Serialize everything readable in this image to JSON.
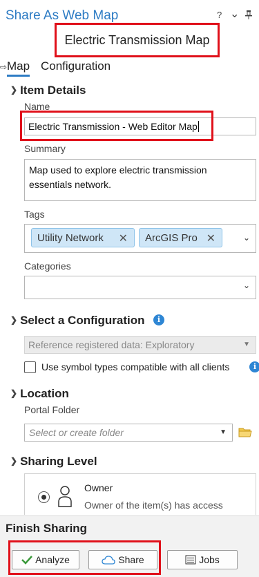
{
  "pane": {
    "title": "Share As Web Map",
    "help": "?",
    "menu_arrow": "⌄",
    "pin": "📌"
  },
  "map_title": "Electric Transmission Map",
  "tabs": [
    {
      "label": "Map",
      "active": true
    },
    {
      "label": "Configuration",
      "active": false
    }
  ],
  "item_details": {
    "header": "Item Details",
    "name_label": "Name",
    "name_value": "Electric Transmission - Web Editor Map",
    "summary_label": "Summary",
    "summary_value": "Map used to explore electric transmission essentials network.",
    "tags_label": "Tags",
    "tags": [
      "Utility Network",
      "ArcGIS Pro"
    ],
    "categories_label": "Categories",
    "categories_value": ""
  },
  "configuration": {
    "header": "Select a Configuration",
    "selected": "Reference registered data: Exploratory",
    "checkbox_label": "Use symbol types compatible with all clients",
    "checked": false
  },
  "location": {
    "header": "Location",
    "portal_folder_label": "Portal Folder",
    "folder_placeholder": "Select or create folder"
  },
  "sharing_level": {
    "header": "Sharing Level",
    "option_label": "Owner",
    "option_desc": "Owner of the item(s) has access",
    "selected": true
  },
  "finish": {
    "header": "Finish Sharing",
    "analyze_label": "Analyze",
    "share_label": "Share",
    "jobs_label": "Jobs"
  },
  "colors": {
    "accent": "#2e7cc4",
    "highlight": "#e0101a",
    "chip_bg": "#cfe6f7",
    "analyze_check": "#3c9a3c"
  },
  "icons": [
    "help-icon",
    "menu-chevron-icon",
    "pin-icon",
    "info-icon",
    "folder-icon",
    "user-icon",
    "checkmark-icon",
    "cloud-icon",
    "jobs-list-icon",
    "chip-remove-icon",
    "dropdown-chevron-icon"
  ]
}
